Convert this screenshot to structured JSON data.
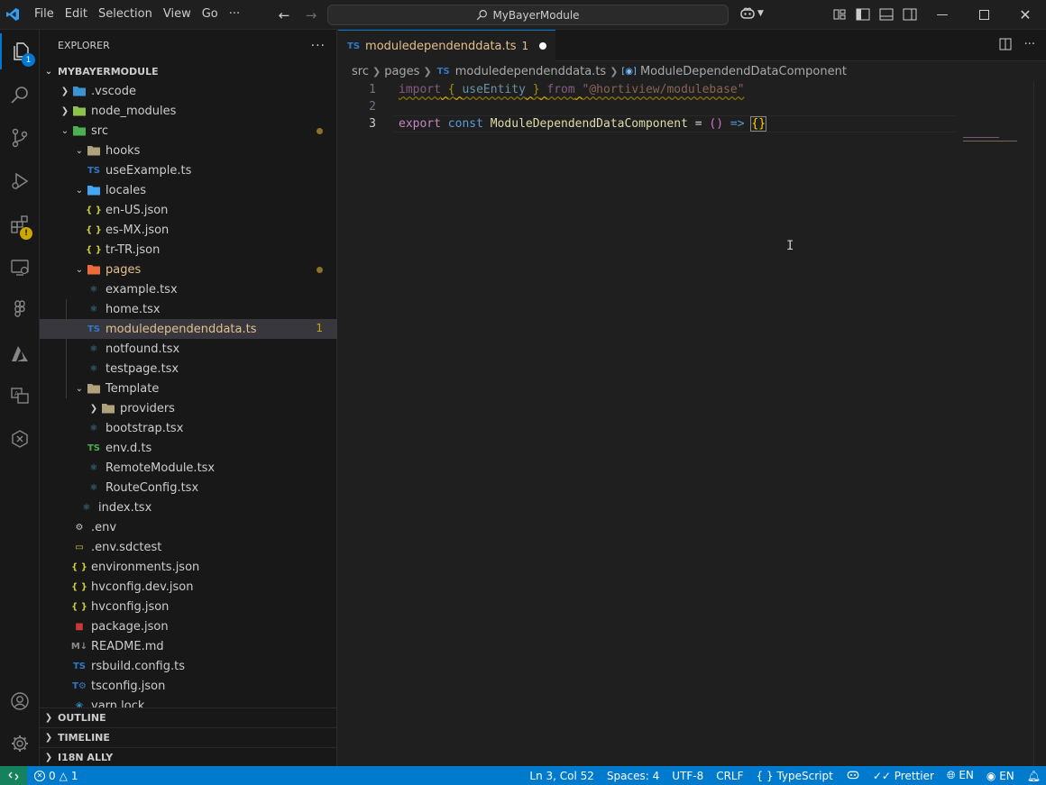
{
  "titlebar": {
    "menu": [
      "File",
      "Edit",
      "Selection",
      "View",
      "Go",
      "···"
    ],
    "search_text": "MyBayerModule"
  },
  "activity_bar": {
    "explorer_badge": "1"
  },
  "sidebar": {
    "title": "EXPLORER",
    "more": "···",
    "root": "MYBAYERMODULE",
    "tree": [
      {
        "label": ".vscode",
        "depth": 0,
        "kind": "folder",
        "chevron": "right",
        "icon": "vscode-folder"
      },
      {
        "label": "node_modules",
        "depth": 0,
        "kind": "folder",
        "chevron": "right",
        "icon": "node-folder"
      },
      {
        "label": "src",
        "depth": 0,
        "kind": "folder",
        "chevron": "down",
        "icon": "src-folder",
        "dot": true
      },
      {
        "label": "hooks",
        "depth": 1,
        "kind": "folder",
        "chevron": "down",
        "icon": "hooks-folder"
      },
      {
        "label": "useExample.ts",
        "depth": 2,
        "kind": "ts"
      },
      {
        "label": "locales",
        "depth": 1,
        "kind": "folder",
        "chevron": "down",
        "icon": "locales-folder"
      },
      {
        "label": "en-US.json",
        "depth": 2,
        "kind": "json"
      },
      {
        "label": "es-MX.json",
        "depth": 2,
        "kind": "json"
      },
      {
        "label": "tr-TR.json",
        "depth": 2,
        "kind": "json"
      },
      {
        "label": "pages",
        "depth": 1,
        "kind": "folder",
        "chevron": "down",
        "icon": "pages-folder",
        "dot": true,
        "modified": true
      },
      {
        "label": "example.tsx",
        "depth": 2,
        "kind": "react"
      },
      {
        "label": "home.tsx",
        "depth": 2,
        "kind": "react"
      },
      {
        "label": "moduledependenddata.ts",
        "depth": 2,
        "kind": "ts",
        "selected": true,
        "modified": true,
        "count": "1"
      },
      {
        "label": "notfound.tsx",
        "depth": 2,
        "kind": "react"
      },
      {
        "label": "testpage.tsx",
        "depth": 2,
        "kind": "react"
      },
      {
        "label": "Template",
        "depth": 1,
        "kind": "folder",
        "chevron": "down",
        "icon": "template-folder"
      },
      {
        "label": "providers",
        "depth": 2,
        "kind": "folder",
        "chevron": "right",
        "icon": "folder"
      },
      {
        "label": "bootstrap.tsx",
        "depth": 2,
        "kind": "react"
      },
      {
        "label": "env.d.ts",
        "depth": 2,
        "kind": "ts-green"
      },
      {
        "label": "RemoteModule.tsx",
        "depth": 2,
        "kind": "react"
      },
      {
        "label": "RouteConfig.tsx",
        "depth": 2,
        "kind": "react"
      },
      {
        "label": "index.tsx",
        "depth": 1,
        "kind": "react"
      },
      {
        "label": ".env",
        "depth": 0,
        "kind": "gear"
      },
      {
        "label": ".env.sdctest",
        "depth": 0,
        "kind": "env"
      },
      {
        "label": "environments.json",
        "depth": 0,
        "kind": "json"
      },
      {
        "label": "hvconfig.dev.json",
        "depth": 0,
        "kind": "json"
      },
      {
        "label": "hvconfig.json",
        "depth": 0,
        "kind": "json"
      },
      {
        "label": "package.json",
        "depth": 0,
        "kind": "npm"
      },
      {
        "label": "README.md",
        "depth": 0,
        "kind": "md"
      },
      {
        "label": "rsbuild.config.ts",
        "depth": 0,
        "kind": "ts"
      },
      {
        "label": "tsconfig.json",
        "depth": 0,
        "kind": "tsconfig"
      },
      {
        "label": "yarn.lock",
        "depth": 0,
        "kind": "yarn"
      }
    ],
    "sections": [
      "OUTLINE",
      "TIMELINE",
      "I18N ALLY"
    ]
  },
  "editor": {
    "tab": {
      "icon": "TS",
      "label": "moduledependenddata.ts",
      "problems": "1"
    },
    "breadcrumb": [
      "src",
      "pages",
      "moduledependenddata.ts",
      "ModuleDependendDataComponent"
    ],
    "lines": [
      "1",
      "2",
      "3"
    ],
    "code": {
      "line1": {
        "kw": "import",
        "ob": "{",
        "name": "useEntity",
        "cb": "}",
        "from": "from",
        "mod": "\"@hortiview/modulebase\""
      },
      "line3": {
        "export": "export",
        "const": "const",
        "name": "ModuleDependendDataComponent",
        "eq": "=",
        "paren": "()",
        "arrow": "=>",
        "body": "{}"
      }
    }
  },
  "statusbar": {
    "errors": "0",
    "warnings": "1",
    "position": "Ln 3, Col 52",
    "spaces": "Spaces: 4",
    "encoding": "UTF-8",
    "eol": "CRLF",
    "language": "TypeScript",
    "prettier": "Prettier",
    "lang1": "EN",
    "lang2": "EN"
  },
  "colors": {
    "accent": "#0078d4",
    "statusbar": "#007acc",
    "modified": "#e2c08d",
    "warning": "#cca700"
  }
}
